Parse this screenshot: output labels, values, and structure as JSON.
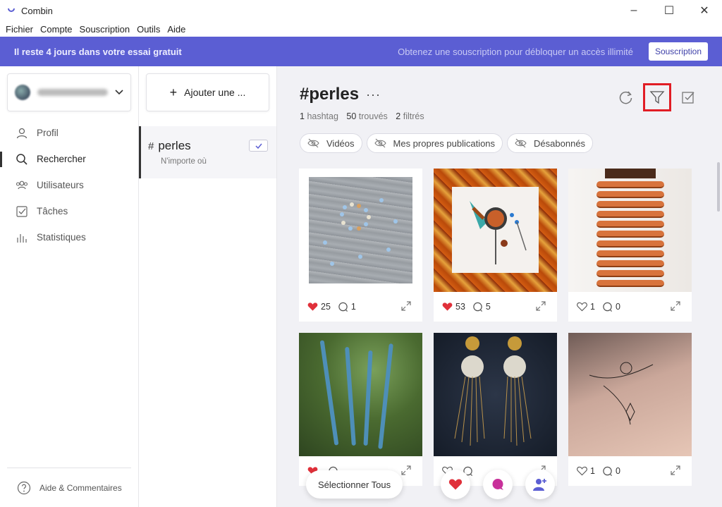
{
  "window": {
    "title": "Combin"
  },
  "menu": [
    "Fichier",
    "Compte",
    "Souscription",
    "Outils",
    "Aide"
  ],
  "trial": {
    "message": "Il reste 4 jours dans votre essai gratuit",
    "cta_text": "Obtenez une souscription pour débloquer un accès illimité",
    "button": "Souscription"
  },
  "sidebar": {
    "items": [
      {
        "label": "Profil",
        "icon": "user-icon"
      },
      {
        "label": "Rechercher",
        "icon": "search-icon",
        "active": true
      },
      {
        "label": "Utilisateurs",
        "icon": "users-icon"
      },
      {
        "label": "Tâches",
        "icon": "tasks-icon"
      },
      {
        "label": "Statistiques",
        "icon": "stats-icon"
      }
    ],
    "footer": "Aide & Commentaires"
  },
  "searches": {
    "add_label": "Ajouter une ...",
    "item": {
      "title": "perles",
      "location": "N'importe où"
    }
  },
  "main": {
    "title": "#perles",
    "more": "···",
    "stats": {
      "hashtag_count": "1",
      "hashtag_label": "hashtag",
      "found_count": "50",
      "found_label": "trouvés",
      "filtered_count": "2",
      "filtered_label": "filtrés"
    },
    "chips": [
      "Vidéos",
      "Mes propres publications",
      "Désabonnés"
    ],
    "posts": [
      {
        "likes": "25",
        "comments": "1",
        "liked": true
      },
      {
        "likes": "53",
        "comments": "5",
        "liked": true
      },
      {
        "likes": "1",
        "comments": "0",
        "liked": false
      },
      {
        "likes": "",
        "comments": "",
        "liked": true
      },
      {
        "likes": "",
        "comments": "",
        "liked": false
      },
      {
        "likes": "1",
        "comments": "0",
        "liked": false
      }
    ],
    "select_all": "Sélectionner Tous"
  },
  "colors": {
    "accent": "#5b5ed3",
    "like": "#e0303a",
    "highlight": "#e11d25"
  }
}
